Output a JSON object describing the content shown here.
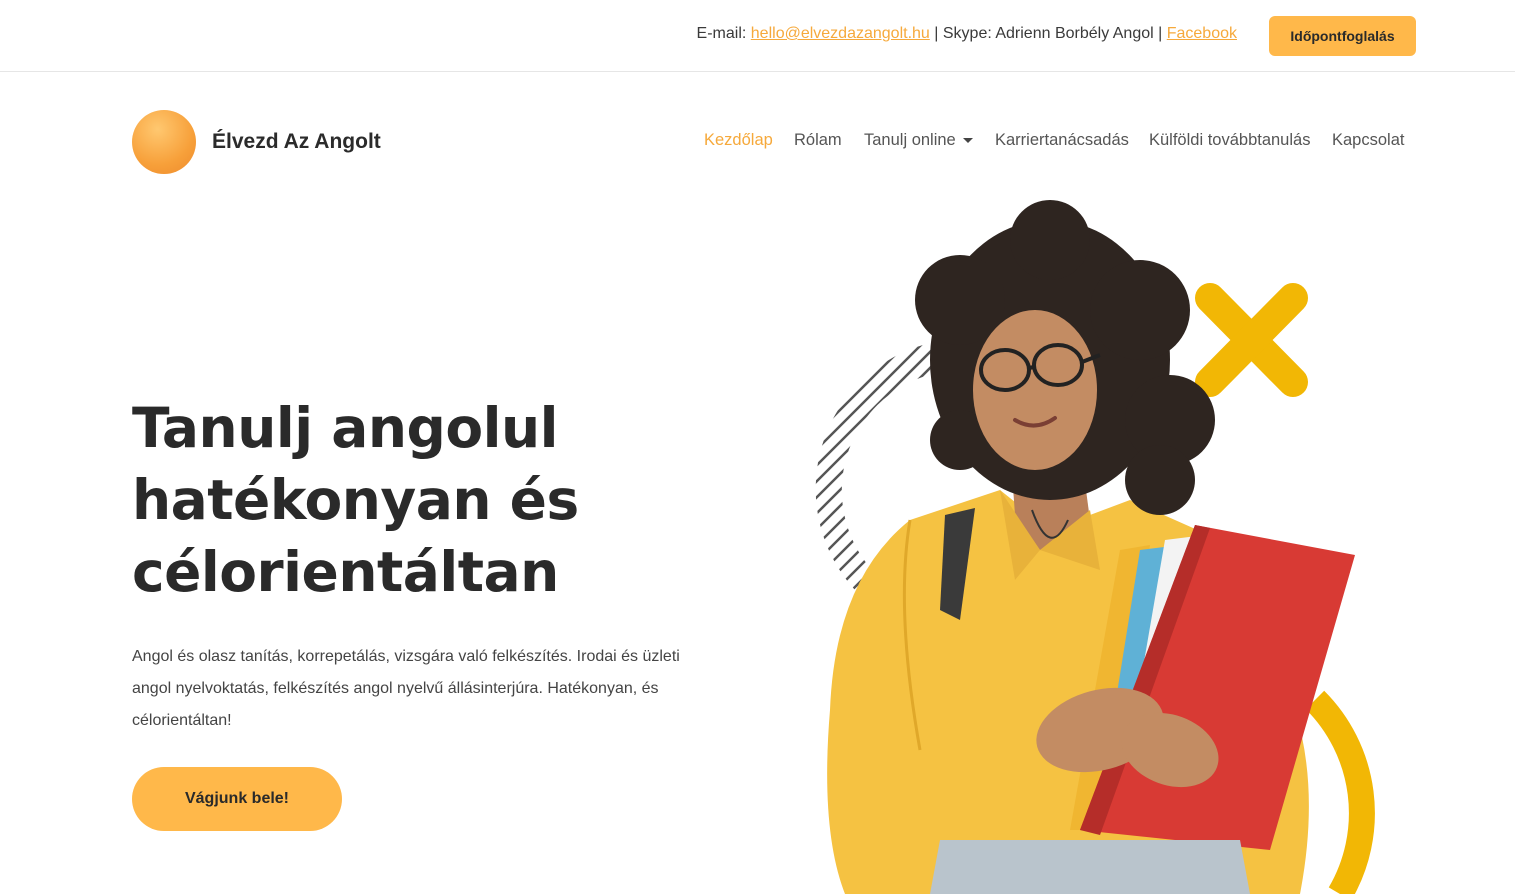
{
  "topbar": {
    "email_label": "E-mail:",
    "email": "hello@elvezdazangolt.hu",
    "skype_text": "| Skype: Adrienn Borbély Angol |",
    "facebook": "Facebook",
    "booking_button": "Időpontfoglalás"
  },
  "brand": {
    "name": "Élvezd Az Angolt"
  },
  "nav": {
    "items": [
      "Kezdőlap",
      "Rólam",
      "Tanulj online",
      "Karriertanácsadás",
      "Külföldi továbbtanulás",
      "Kapcsolat"
    ],
    "active": "Kezdőlap"
  },
  "hero": {
    "title_lines": [
      "Tanulj angolul",
      "hatékonyan és",
      "célorientáltan"
    ],
    "description": "Angol és olasz tanítás, korrepetálás, vizsgára való felkészítés. Irodai és üzleti angol nyelvoktatás, felkészítés angol nyelvű állásinterjúra. Hatékonyan, és célorientáltan!",
    "cta_button": "Vágjunk bele!"
  },
  "colors": {
    "accent": "#ffb84a",
    "link": "#f6a93b",
    "shape_yellow": "#f2b705",
    "shirt": "#f5c242",
    "folder": "#d83a34"
  },
  "icons": [
    "logo-circle",
    "caret-down-icon",
    "x-shape",
    "arc-shape",
    "striped-arc-shape"
  ]
}
